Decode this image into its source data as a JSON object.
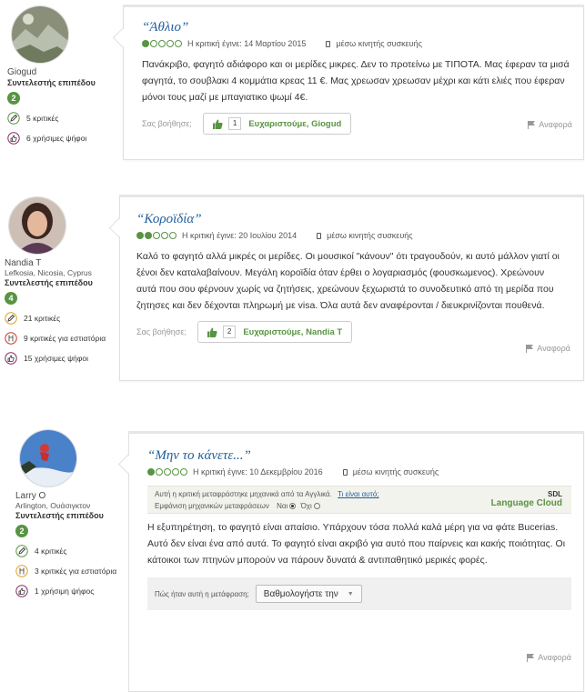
{
  "reviews": [
    {
      "user": {
        "name": "Giogud",
        "location": "",
        "contributor_label": "Συντελεστής επιπέδου",
        "level": "2",
        "stats": [
          {
            "icon": "pencil-icon",
            "text": "5 κριτικές"
          },
          {
            "icon": "thumbs-up-icon",
            "text": "6 χρήσιμες ψήφοι"
          }
        ]
      },
      "title": "“Άθλιο”",
      "rating": 1,
      "date_text": "Η κριτική έγινε: 14 Μαρτίου 2015",
      "via_text": "μέσω κινητής συσκευής",
      "body": "Πανάκριβο, φαγητό αδιάφορο και οι μερίδες μικρες. Δεν το προτείνω με ΤΙΠΟΤΑ. Μας έφεραν τα μισά φαγητά, το σουβλακι 4 κομμάτια κρεας 11 €. Μας χρεωσαν χρεωσαν μέχρι και κάτι ελιές που έφεραν μόνοι τους μαζί με μπαγιατικο ψωμί 4€.",
      "helpful_label": "Σας βοήθησε;",
      "helpful_count": "1",
      "thanks_label": "Ευχαριστούμε, Giogud",
      "report_label": "Αναφορά"
    },
    {
      "user": {
        "name": "Nandia T",
        "location": "Lefkosia, Nicosia, Cyprus",
        "contributor_label": "Συντελεστής επιπέδου",
        "level": "4",
        "stats": [
          {
            "icon": "pencil-icon",
            "text": "21 κριτικές"
          },
          {
            "icon": "restaurant-icon",
            "text": "9 κριτικές για εστιατόρια"
          },
          {
            "icon": "thumbs-up-icon",
            "text": "15 χρήσιμες ψήφοι"
          }
        ]
      },
      "title": "“Κοροϊδία”",
      "rating": 2,
      "date_text": "Η κριτική έγινε: 20 Ιουλίου 2014",
      "via_text": "μέσω κινητής συσκευής",
      "body": "Καλό το φαγητό αλλά μικρές οι μερίδες. Οι μουσικοί \"κάνουν\" ότι τραγουδούν, κι αυτό μάλλον γιατί οι ξένοι δεν καταλαβαίνουν. Μεγάλη κοροϊδία όταν έρθει ο λογαριασμός (φουσκωμενος). Χρεώνουν αυτά που σου φέρνουν χωρίς να ζητήσεις, χρεώνουν ξεχωριστά το συνοδευτικό από τη μερίδα που ζητησες και δεν δέχονται πληρωμή με visa. Όλα αυτά δεν αναφέρονται / διευκρινίζονται πουθενά.",
      "helpful_label": "Σας βοήθησε;",
      "helpful_count": "2",
      "thanks_label": "Ευχαριστούμε, Nandia T",
      "report_label": "Αναφορά"
    },
    {
      "user": {
        "name": "Larry O",
        "location": "Arlington, Ουάσιγκτον",
        "contributor_label": "Συντελεστής επιπέδου",
        "level": "2",
        "stats": [
          {
            "icon": "pencil-icon",
            "text": "4 κριτικές"
          },
          {
            "icon": "restaurant-icon",
            "text": "3 κριτικές για εστιατόρια"
          },
          {
            "icon": "thumbs-up-icon",
            "text": "1 χρήσιμη ψήφος"
          }
        ]
      },
      "title": "“Μην το κάνετε...”",
      "rating": 1,
      "date_text": "Η κριτική έγινε: 10 Δεκεμβρίου 2016",
      "via_text": "μέσω κινητής συσκευής",
      "translation": {
        "notice": "Αυτή η κριτική μεταφράστηκε μηχανικά από τα Αγγλικά.",
        "link": "Τι είναι αυτό;",
        "show_label": "Εμφάνιση μηχανικών μεταφράσεων",
        "yes": "Ναι",
        "no": "Όχι",
        "brand_top": "SDL",
        "brand_bottom": "Language Cloud"
      },
      "body": "Η εξυπηρέτηση, το φαγητό είναι απαίσιο. Υπάρχουν τόσα πολλά καλά μέρη για να φάτε Bucerias. Αυτό δεν είναι ένα από αυτά. Το φαγητό είναι ακριβό για αυτό που παίρνεις και κακής ποιότητας. Οι κάτοικοι των πτηνών μπορούν να πάρουν δυνατά & αντιπαθητικό μερικές φορές.",
      "rate_translation_label": "Πώς ήταν αυτή η μετάφραση;",
      "rate_select_value": "Βαθμολογήστε την",
      "report_label": "Αναφορά"
    }
  ],
  "colors": {
    "accent_green": "#589442",
    "title_blue": "#1f5d9c"
  }
}
